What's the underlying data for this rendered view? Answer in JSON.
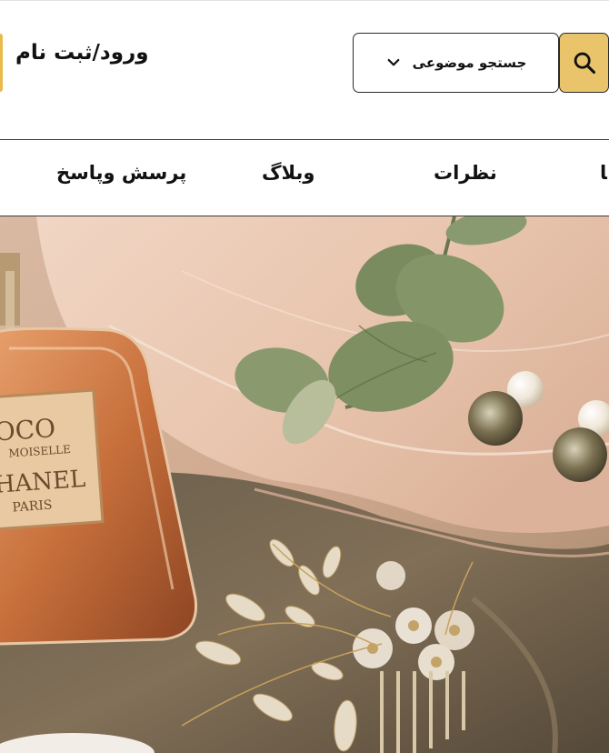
{
  "header": {
    "login_label": "ورود/ثبت نام",
    "search_select_label": "جستجو موضوعی",
    "search_icon": "search-icon",
    "dropdown_icon": "chevron-down-icon",
    "accent_color": "#e9c46a"
  },
  "nav": {
    "items": [
      {
        "label": "پرسش وپاسخ"
      },
      {
        "label": "وبلاگ"
      },
      {
        "label": "نظرات"
      },
      {
        "label": "ﺎ"
      }
    ]
  },
  "hero": {
    "bottle_label_lines": [
      "OCO",
      "MOISELLE",
      "HANEL",
      "PARIS"
    ]
  }
}
